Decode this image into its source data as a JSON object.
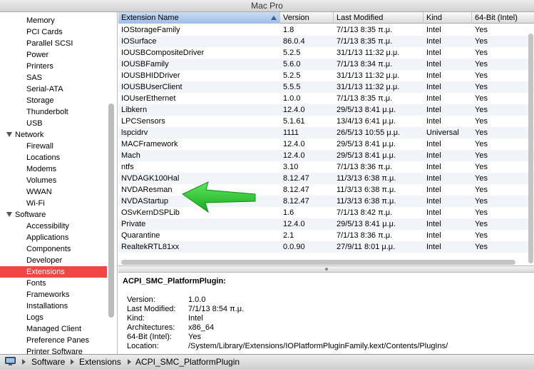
{
  "window": {
    "title": "Mac Pro"
  },
  "sidebar": {
    "items": [
      {
        "label": "Memory",
        "kind": "child"
      },
      {
        "label": "PCI Cards",
        "kind": "child"
      },
      {
        "label": "Parallel SCSI",
        "kind": "child"
      },
      {
        "label": "Power",
        "kind": "child"
      },
      {
        "label": "Printers",
        "kind": "child"
      },
      {
        "label": "SAS",
        "kind": "child"
      },
      {
        "label": "Serial-ATA",
        "kind": "child"
      },
      {
        "label": "Storage",
        "kind": "child"
      },
      {
        "label": "Thunderbolt",
        "kind": "child"
      },
      {
        "label": "USB",
        "kind": "child"
      },
      {
        "label": "Network",
        "kind": "group"
      },
      {
        "label": "Firewall",
        "kind": "child"
      },
      {
        "label": "Locations",
        "kind": "child"
      },
      {
        "label": "Modems",
        "kind": "child"
      },
      {
        "label": "Volumes",
        "kind": "child"
      },
      {
        "label": "WWAN",
        "kind": "child"
      },
      {
        "label": "Wi-Fi",
        "kind": "child"
      },
      {
        "label": "Software",
        "kind": "group"
      },
      {
        "label": "Accessibility",
        "kind": "child"
      },
      {
        "label": "Applications",
        "kind": "child"
      },
      {
        "label": "Components",
        "kind": "child"
      },
      {
        "label": "Developer",
        "kind": "child"
      },
      {
        "label": "Extensions",
        "kind": "child",
        "selected": true
      },
      {
        "label": "Fonts",
        "kind": "child"
      },
      {
        "label": "Frameworks",
        "kind": "child"
      },
      {
        "label": "Installations",
        "kind": "child"
      },
      {
        "label": "Logs",
        "kind": "child"
      },
      {
        "label": "Managed Client",
        "kind": "child"
      },
      {
        "label": "Preference Panes",
        "kind": "child"
      },
      {
        "label": "Printer Software",
        "kind": "child"
      }
    ]
  },
  "table": {
    "columns": [
      "Extension Name",
      "Version",
      "Last Modified",
      "Kind",
      "64-Bit (Intel)"
    ],
    "rows": [
      [
        "IOStorageFamily",
        "1.8",
        "7/1/13 8:35 π.μ.",
        "Intel",
        "Yes"
      ],
      [
        "IOSurface",
        "86.0.4",
        "7/1/13 8:35 π.μ.",
        "Intel",
        "Yes"
      ],
      [
        "IOUSBCompositeDriver",
        "5.2.5",
        "31/1/13 11:32 μ.μ.",
        "Intel",
        "Yes"
      ],
      [
        "IOUSBFamily",
        "5.6.0",
        "7/1/13 8:34 π.μ.",
        "Intel",
        "Yes"
      ],
      [
        "IOUSBHIDDriver",
        "5.2.5",
        "31/1/13 11:32 μ.μ.",
        "Intel",
        "Yes"
      ],
      [
        "IOUSBUserClient",
        "5.5.5",
        "31/1/13 11:32 μ.μ.",
        "Intel",
        "Yes"
      ],
      [
        "IOUserEthernet",
        "1.0.0",
        "7/1/13 8:35 π.μ.",
        "Intel",
        "Yes"
      ],
      [
        "Libkern",
        "12.4.0",
        "29/5/13 8:41 μ.μ.",
        "Intel",
        "Yes"
      ],
      [
        "LPCSensors",
        "5.1.61",
        "13/4/13 6:41 μ.μ.",
        "Intel",
        "Yes"
      ],
      [
        "lspcidrv",
        "1111",
        "26/5/13 10:55 μ.μ.",
        "Universal",
        "Yes"
      ],
      [
        "MACFramework",
        "12.4.0",
        "29/5/13 8:41 μ.μ.",
        "Intel",
        "Yes"
      ],
      [
        "Mach",
        "12.4.0",
        "29/5/13 8:41 μ.μ.",
        "Intel",
        "Yes"
      ],
      [
        "ntfs",
        "3.10",
        "7/1/13 8:36 π.μ.",
        "Intel",
        "Yes"
      ],
      [
        "NVDAGK100Hal",
        "8.12.47",
        "11/3/13 6:38 π.μ.",
        "Intel",
        "Yes"
      ],
      [
        "NVDAResman",
        "8.12.47",
        "11/3/13 6:38 π.μ.",
        "Intel",
        "Yes"
      ],
      [
        "NVDAStartup",
        "8.12.47",
        "11/3/13 6:38 π.μ.",
        "Intel",
        "Yes"
      ],
      [
        "OSvKernDSPLib",
        "1.6",
        "7/1/13 8:42 π.μ.",
        "Intel",
        "Yes"
      ],
      [
        "Private",
        "12.4.0",
        "29/5/13 8:41 μ.μ.",
        "Intel",
        "Yes"
      ],
      [
        "Quarantine",
        "2.1",
        "7/1/13 8:36 π.μ.",
        "Intel",
        "Yes"
      ],
      [
        "RealtekRTL81xx",
        "0.0.90",
        "27/9/11 8:01 μ.μ.",
        "Intel",
        "Yes"
      ]
    ]
  },
  "detail": {
    "title": "ACPI_SMC_PlatformPlugin:",
    "fields": [
      {
        "label": "Version:",
        "value": "1.0.0"
      },
      {
        "label": "Last Modified:",
        "value": "7/1/13 8:54 π.μ."
      },
      {
        "label": "Kind:",
        "value": "Intel"
      },
      {
        "label": "Architectures:",
        "value": "x86_64"
      },
      {
        "label": "64-Bit (Intel):",
        "value": "Yes"
      },
      {
        "label": "Location:",
        "value": "/System/Library/Extensions/IOPlatformPluginFamily.kext/Contents/PlugIns/"
      }
    ]
  },
  "pathbar": {
    "crumbs": [
      "Software",
      "Extensions",
      "ACPI_SMC_PlatformPlugin"
    ]
  },
  "colors": {
    "selection": "#f04646",
    "arrow": "#22c22a",
    "sorted_header": "#9ebde6"
  }
}
